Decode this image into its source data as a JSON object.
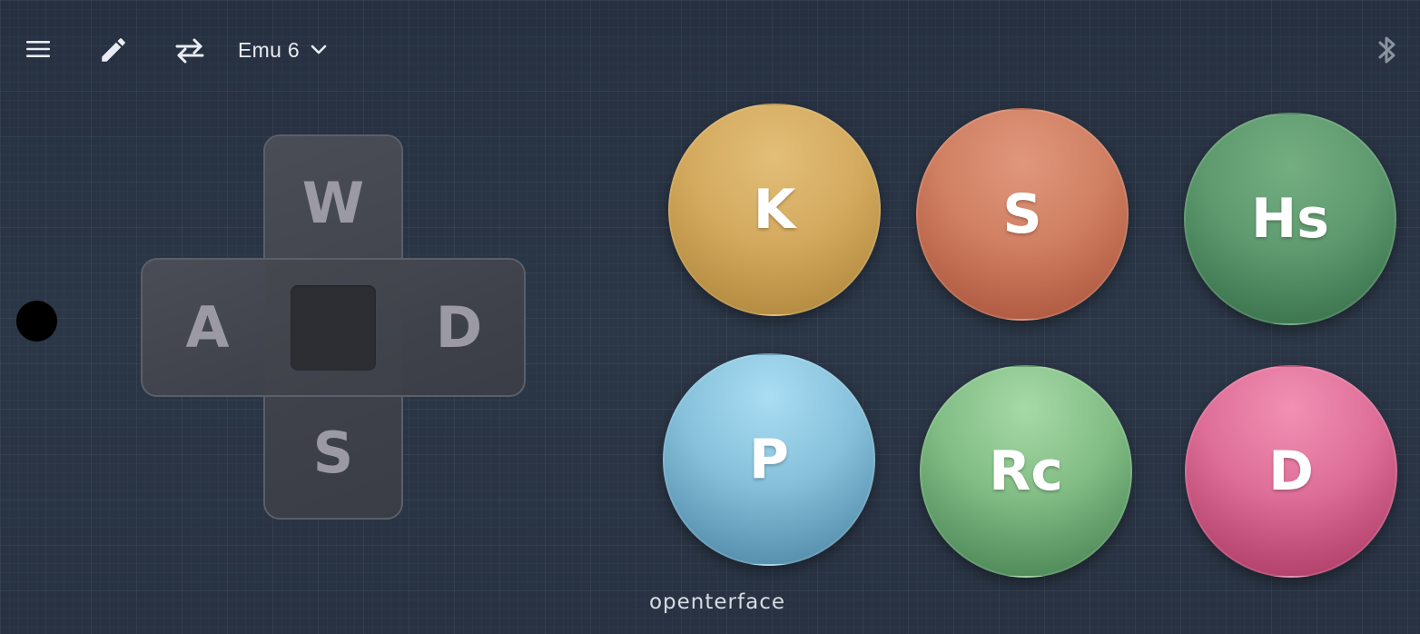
{
  "toolbar": {
    "menu_icon": "menu-icon",
    "edit_icon": "pencil-icon",
    "swap_icon": "swap-arrows-icon",
    "profile_name": "Emu 6",
    "profile_dropdown_icon": "chevron-down-icon",
    "bluetooth_icon": "bluetooth-icon"
  },
  "dpad": {
    "up": "W",
    "left": "A",
    "right": "D",
    "down": "S"
  },
  "action_buttons": [
    {
      "label": "K",
      "color": "#d4aa5f"
    },
    {
      "label": "S",
      "color": "#d07f62"
    },
    {
      "label": "Hs",
      "color": "#5f9a6f"
    },
    {
      "label": "P",
      "color": "#86c0da"
    },
    {
      "label": "Rc",
      "color": "#82bd85"
    },
    {
      "label": "D",
      "color": "#dd6e97"
    }
  ],
  "footer": {
    "brand": "openterface"
  },
  "colors": {
    "background": "#2a3444",
    "toolbar_icon": "#e9edf3",
    "bluetooth_icon": "#8a93a0",
    "dpad_key_text": "#9b9aa4"
  }
}
